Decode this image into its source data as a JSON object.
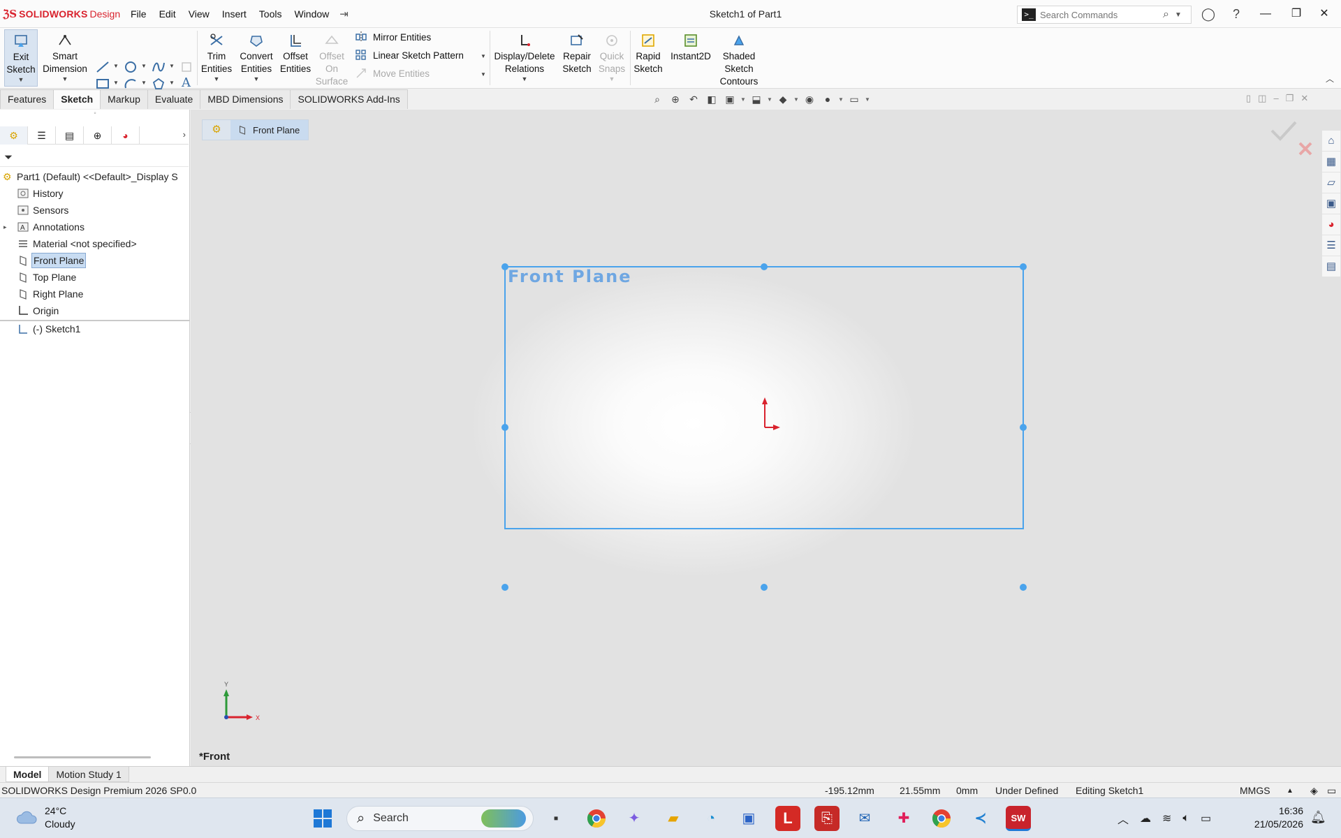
{
  "app": {
    "brand": "SOLIDWORKS",
    "brand_suffix": "Design",
    "document_title": "Sketch1 of Part1"
  },
  "menu": [
    "File",
    "Edit",
    "View",
    "Insert",
    "Tools",
    "Window"
  ],
  "search": {
    "placeholder": "Search Commands"
  },
  "ribbon": {
    "exit_sketch": "Exit\nSketch",
    "smart_dimension": "Smart\nDimension",
    "trim_entities": "Trim\nEntities",
    "convert_entities": "Convert\nEntities",
    "offset_entities": "Offset\nEntities",
    "offset_on_surface": "Offset\nOn\nSurface",
    "mirror_entities": "Mirror Entities",
    "linear_sketch_pattern": "Linear Sketch Pattern",
    "move_entities": "Move Entities",
    "display_delete_relations": "Display/Delete\nRelations",
    "repair_sketch": "Repair\nSketch",
    "quick_snaps": "Quick\nSnaps",
    "rapid_sketch": "Rapid\nSketch",
    "instant2d": "Instant2D",
    "shaded_sketch_contours": "Shaded\nSketch\nContours"
  },
  "command_tabs": [
    "Features",
    "Sketch",
    "Markup",
    "Evaluate",
    "MBD Dimensions",
    "SOLIDWORKS Add-Ins"
  ],
  "active_command_tab": "Sketch",
  "feature_tree": {
    "root": "Part1 (Default) <<Default>_Display S",
    "items": [
      {
        "label": "History"
      },
      {
        "label": "Sensors"
      },
      {
        "label": "Annotations"
      },
      {
        "label": "Material <not specified>"
      },
      {
        "label": "Front Plane"
      },
      {
        "label": "Top Plane"
      },
      {
        "label": "Right Plane"
      },
      {
        "label": "Origin"
      },
      {
        "label": "(-) Sketch1"
      }
    ]
  },
  "viewport": {
    "breadcrumb_plane": "Front Plane",
    "plane_label": "Front Plane",
    "view_name": "*Front",
    "triad_x": "X",
    "triad_y": "Y"
  },
  "bottom_tabs": [
    "Model",
    "Motion Study 1"
  ],
  "status": {
    "product": "SOLIDWORKS Design Premium 2026 SP0.0",
    "x": "-195.12mm",
    "y": "21.55mm",
    "z": "0mm",
    "state": "Under Defined",
    "editing": "Editing Sketch1",
    "units": "MMGS"
  },
  "taskbar": {
    "temperature": "24°C",
    "weather": "Cloudy",
    "search_label": "Search",
    "time": "16:36",
    "date": "21/05/2026"
  },
  "colors": {
    "accent_red": "#d9232e",
    "sketch_blue": "#4aa3ec",
    "selection_bg": "#c8dcf2"
  }
}
